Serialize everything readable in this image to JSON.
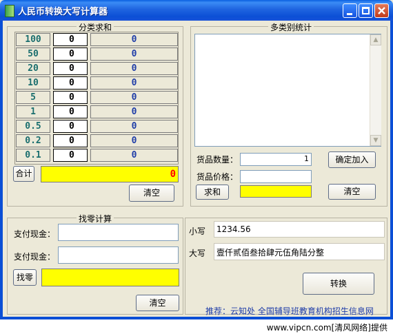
{
  "window": {
    "title": "人民币转换大写计算器"
  },
  "sum_section": {
    "title": "分类求和",
    "rows": [
      {
        "denomination": "100",
        "quantity": "0",
        "result": "0"
      },
      {
        "denomination": "50",
        "quantity": "0",
        "result": "0"
      },
      {
        "denomination": "20",
        "quantity": "0",
        "result": "0"
      },
      {
        "denomination": "10",
        "quantity": "0",
        "result": "0"
      },
      {
        "denomination": "5",
        "quantity": "0",
        "result": "0"
      },
      {
        "denomination": "1",
        "quantity": "0",
        "result": "0"
      },
      {
        "denomination": "0.5",
        "quantity": "0",
        "result": "0"
      },
      {
        "denomination": "0.2",
        "quantity": "0",
        "result": "0"
      },
      {
        "denomination": "0.1",
        "quantity": "0",
        "result": "0"
      }
    ],
    "total_button": "合计",
    "total_value": "0",
    "clear_button": "清空"
  },
  "multi_section": {
    "title": "多类别统计",
    "list_text": "",
    "quantity_label": "货品数量：",
    "quantity_value": "1",
    "add_button": "确定加入",
    "price_label": "货品价格：",
    "price_value": "",
    "sum_button": "求和",
    "sum_value": "",
    "clear_button": "清空"
  },
  "change_section": {
    "title": "找零计算",
    "pay1_label": "支付现金：",
    "pay1_value": "",
    "pay2_label": "支付现金：",
    "pay2_value": "",
    "change_button": "找零",
    "change_value": "",
    "clear_button": "清空"
  },
  "convert_section": {
    "lower_label": "小写",
    "lower_value": "1234.56",
    "upper_label": "大写",
    "upper_value": "壹仟贰佰叁拾肆元伍角陆分整",
    "convert_button": "转换",
    "promo_text": "推荐：云知处 全国辅导班教育机构招生信息网"
  },
  "watermark": "www.vipcn.com[清风网络]提供",
  "colors": {
    "title_bar": "#0b4fd6",
    "highlight": "#ffff00",
    "window_bg": "#ece9d8"
  }
}
